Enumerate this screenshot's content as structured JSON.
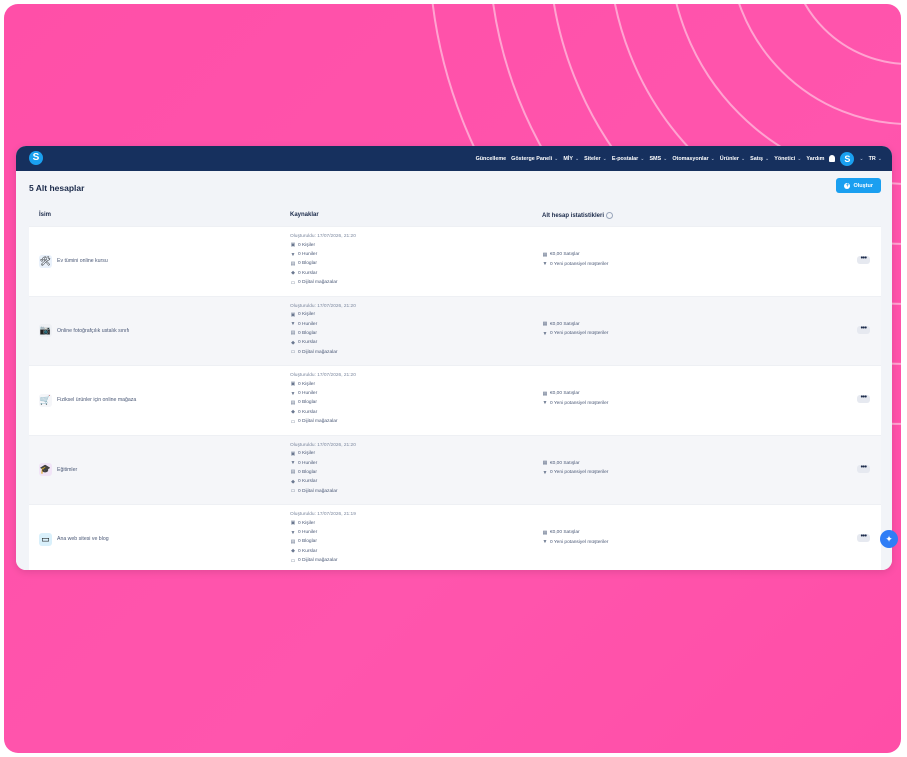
{
  "nav": {
    "items": [
      {
        "label": "Güncelleme",
        "has_dropdown": false
      },
      {
        "label": "Gösterge Paneli",
        "has_dropdown": true
      },
      {
        "label": "MİY",
        "has_dropdown": true
      },
      {
        "label": "Siteler",
        "has_dropdown": true
      },
      {
        "label": "E-postalar",
        "has_dropdown": true
      },
      {
        "label": "SMS",
        "has_dropdown": true
      },
      {
        "label": "Otomasyonlar",
        "has_dropdown": true
      },
      {
        "label": "Ürünler",
        "has_dropdown": true
      },
      {
        "label": "Satış",
        "has_dropdown": true
      },
      {
        "label": "Yönetici",
        "has_dropdown": true
      },
      {
        "label": "Yardım",
        "has_dropdown": false
      }
    ],
    "avatar_letter": "S",
    "language": "TR",
    "logo_letter": "S"
  },
  "page": {
    "title": "5 Alt hesaplar",
    "create_button": "Oluştur"
  },
  "table": {
    "headers": {
      "name": "İsim",
      "resources": "Kaynaklar",
      "stats": "Alt hesap istatistikleri"
    },
    "rows": [
      {
        "name": "Ev tümini online kursu",
        "icon": "handyman-icon",
        "icon_bg": "#e9f1fb",
        "created": "Oluşturuldu: 17/07/2026, 21:20",
        "contacts": "0 Kişiler",
        "funnels": "0 Huniler",
        "blogs": "0 Bloglar",
        "courses": "0 Kurslar",
        "stores": "0 Dijital mağazalar",
        "sales": "€0,00 Satışlar",
        "prospects": "0 Yeni potansiyel müşteriler"
      },
      {
        "name": "Online fotoğrafçılık ustalık sınıfı",
        "icon": "camera-icon",
        "icon_bg": "#eef0f4",
        "created": "Oluşturuldu: 17/07/2026, 21:20",
        "contacts": "0 Kişiler",
        "funnels": "0 Huniler",
        "blogs": "0 Bloglar",
        "courses": "0 Kurslar",
        "stores": "0 Dijital mağazalar",
        "sales": "€0,00 Satışlar",
        "prospects": "0 Yeni potansiyel müşteriler"
      },
      {
        "name": "Fiziksel ürünler için online mağaza",
        "icon": "cart-icon",
        "icon_bg": "#f5f6f9",
        "created": "Oluşturuldu: 17/07/2026, 21:20",
        "contacts": "0 Kişiler",
        "funnels": "0 Huniler",
        "blogs": "0 Bloglar",
        "courses": "0 Kurslar",
        "stores": "0 Dijital mağazalar",
        "sales": "€0,00 Satışlar",
        "prospects": "0 Yeni potansiyel müşteriler"
      },
      {
        "name": "Eğitimler",
        "icon": "education-icon",
        "icon_bg": "#f1e4f7",
        "created": "Oluşturuldu: 17/07/2026, 21:20",
        "contacts": "0 Kişiler",
        "funnels": "0 Huniler",
        "blogs": "0 Bloglar",
        "courses": "0 Kurslar",
        "stores": "0 Dijital mağazalar",
        "sales": "€0,00 Satışlar",
        "prospects": "0 Yeni potansiyel müşteriler"
      },
      {
        "name": "Ana web sitesi ve blog",
        "icon": "website-icon",
        "icon_bg": "#d9f0fb",
        "created": "Oluşturuldu: 17/07/2026, 21:19",
        "contacts": "0 Kişiler",
        "funnels": "0 Huniler",
        "blogs": "0 Bloglar",
        "courses": "0 Kurslar",
        "stores": "0 Dijital mağazalar",
        "sales": "€0,00 Satışlar",
        "prospects": "0 Yeni potansiyel müşteriler"
      }
    ],
    "more_label": "•••"
  },
  "colors": {
    "background": "#ff4fa8",
    "topbar": "#16305e",
    "accent": "#1a9ff0"
  }
}
